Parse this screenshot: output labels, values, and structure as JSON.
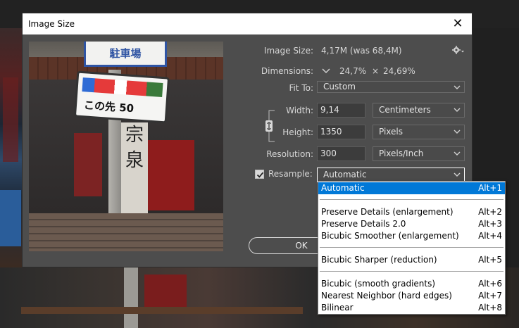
{
  "dialog": {
    "title": "Image Size",
    "close_glyph": "✕"
  },
  "preview": {
    "sign_top_text": "駐車場",
    "sign_bottom_text": "この先 50",
    "kanji_column": "宗泉",
    "alt": "preview-image"
  },
  "info": {
    "image_size_label": "Image Size:",
    "image_size_value": "4,17M (was 68,4M)",
    "dimensions_label": "Dimensions:",
    "dimensions_width": "24,7%",
    "dimensions_times": "×",
    "dimensions_height": "24,69%",
    "fit_to_label": "Fit To:",
    "fit_to_value": "Custom"
  },
  "fields": {
    "width_label": "Width:",
    "width_value": "9,14",
    "width_unit": "Centimeters",
    "height_label": "Height:",
    "height_value": "1350",
    "height_unit": "Pixels",
    "resolution_label": "Resolution:",
    "resolution_value": "300",
    "resolution_unit": "Pixels/Inch",
    "resample_label": "Resample:",
    "resample_value": "Automatic",
    "resample_checked": true
  },
  "buttons": {
    "ok": "OK"
  },
  "resample_options": [
    {
      "name": "Automatic",
      "key": "Alt+1",
      "selected": true
    },
    {
      "name": "Preserve Details (enlargement)",
      "key": "Alt+2"
    },
    {
      "name": "Preserve Details 2.0",
      "key": "Alt+3"
    },
    {
      "name": "Bicubic Smoother (enlargement)",
      "key": "Alt+4"
    },
    {
      "name": "Bicubic Sharper (reduction)",
      "key": "Alt+5"
    },
    {
      "name": "Bicubic (smooth gradients)",
      "key": "Alt+6"
    },
    {
      "name": "Nearest Neighbor (hard edges)",
      "key": "Alt+7"
    },
    {
      "name": "Bilinear",
      "key": "Alt+8"
    }
  ],
  "colors": {
    "dialog_bg": "#4d4d4d",
    "selection": "#0078d7",
    "text": "#d6d6d6"
  }
}
